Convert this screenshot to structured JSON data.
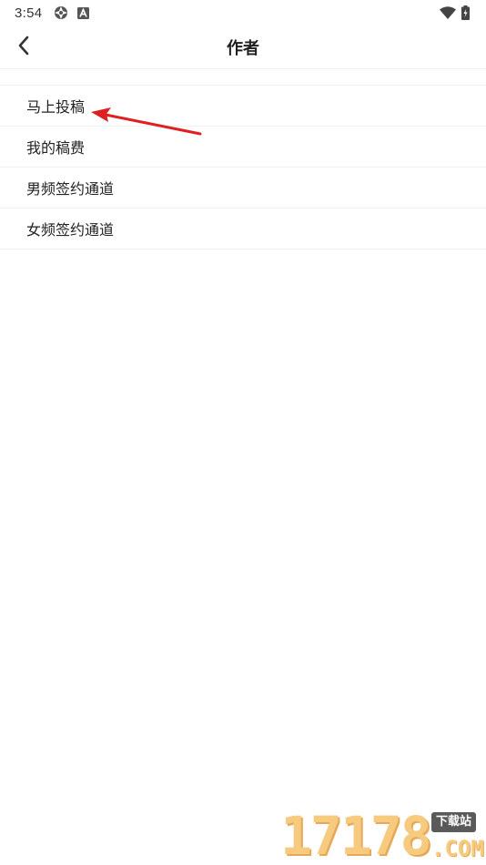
{
  "status_bar": {
    "time": "3:54",
    "left_icons": [
      "aperture-icon",
      "font-a-icon"
    ],
    "right_icons": [
      "wifi-icon",
      "battery-icon"
    ]
  },
  "header": {
    "title": "作者",
    "back_icon": "chevron-left-icon"
  },
  "menu": {
    "items": [
      {
        "label": "马上投稿"
      },
      {
        "label": "我的稿费"
      },
      {
        "label": "男频签约通道"
      },
      {
        "label": "女频签约通道"
      }
    ]
  },
  "annotation": {
    "type": "red-arrow",
    "target": "马上投稿",
    "color": "#e02020"
  },
  "watermark": {
    "digits": "17178",
    "badge": "下载站",
    "domain": ".COM"
  },
  "colors": {
    "background": "#ffffff",
    "text": "#222222",
    "divider": "#f1f1f1",
    "arrow": "#e02020"
  }
}
